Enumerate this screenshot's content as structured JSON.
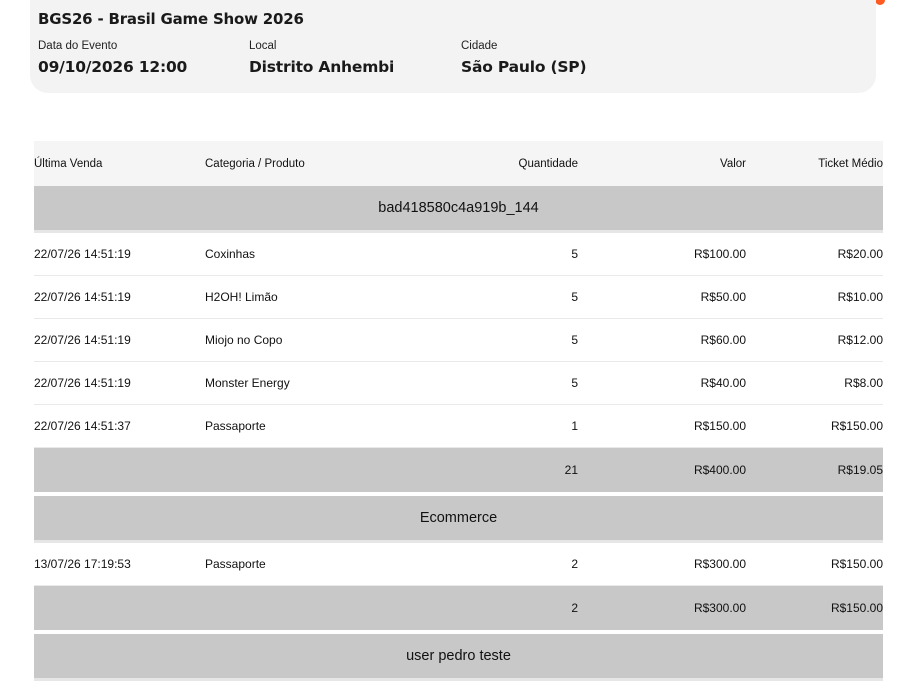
{
  "event": {
    "title": "BGS26 - Brasil Game Show 2026",
    "date_label": "Data do Evento",
    "date_value": "09/10/2026 12:00",
    "place_label": "Local",
    "place_value": "Distrito Anhembi",
    "city_label": "Cidade",
    "city_value": "São Paulo (SP)"
  },
  "colors": {
    "accent": "#ff5a1f",
    "card_bg": "#f3f3f3",
    "group_bg": "#c8c8c8"
  },
  "table": {
    "headers": {
      "last_sale": "Última Venda",
      "category": "Categoria / Produto",
      "quantity": "Quantidade",
      "value": "Valor",
      "ticket": "Ticket Médio"
    },
    "groups": [
      {
        "name": "bad418580c4a919b_144",
        "rows": [
          {
            "date": "22/07/26 14:51:19",
            "product": "Coxinhas",
            "qty": "5",
            "value": "R$100.00",
            "ticket": "R$20.00"
          },
          {
            "date": "22/07/26 14:51:19",
            "product": "H2OH! Limão",
            "qty": "5",
            "value": "R$50.00",
            "ticket": "R$10.00"
          },
          {
            "date": "22/07/26 14:51:19",
            "product": "Miojo no Copo",
            "qty": "5",
            "value": "R$60.00",
            "ticket": "R$12.00"
          },
          {
            "date": "22/07/26 14:51:19",
            "product": "Monster Energy",
            "qty": "5",
            "value": "R$40.00",
            "ticket": "R$8.00"
          },
          {
            "date": "22/07/26 14:51:37",
            "product": "Passaporte",
            "qty": "1",
            "value": "R$150.00",
            "ticket": "R$150.00"
          }
        ],
        "total": {
          "qty": "21",
          "value": "R$400.00",
          "ticket": "R$19.05"
        }
      },
      {
        "name": "Ecommerce",
        "rows": [
          {
            "date": "13/07/26 17:19:53",
            "product": "Passaporte",
            "qty": "2",
            "value": "R$300.00",
            "ticket": "R$150.00"
          }
        ],
        "total": {
          "qty": "2",
          "value": "R$300.00",
          "ticket": "R$150.00"
        }
      },
      {
        "name": "user pedro teste",
        "rows": [],
        "total": null
      }
    ]
  }
}
